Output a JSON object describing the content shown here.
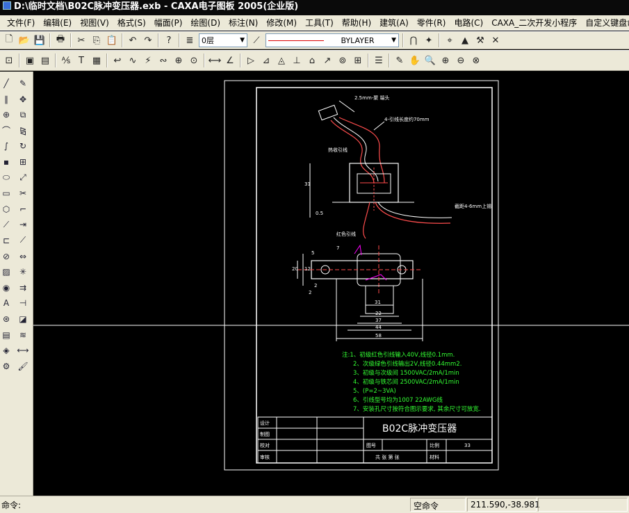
{
  "window": {
    "title": "D:\\临时文档\\B02C脉冲变压器.exb - CAXA电子图板 2005(企业版)"
  },
  "menu": [
    "文件(F)",
    "编辑(E)",
    "视图(V)",
    "格式(S)",
    "幅面(P)",
    "绘图(D)",
    "标注(N)",
    "修改(M)",
    "工具(T)",
    "帮助(H)",
    "建筑(A)",
    "零件(R)",
    "电路(C)",
    "CAXA_二次开发小程序",
    "自定义键盘命令"
  ],
  "toolbar": {
    "layer_value": "0层",
    "linetype_value": "BYLAYER"
  },
  "drawing": {
    "labels": {
      "top_lead": "2.5mm-聚 端头",
      "lead_wire": "4-引线长度约70mm",
      "heat_shrink": "热收引线",
      "dim_h": "31",
      "dim_small": "0.5",
      "right_lead": "截距4-6mm上锡",
      "red_lead": "红色引线",
      "dim_7": "7",
      "dim_a": "20",
      "dim_b": "12",
      "dim_c": "5",
      "dim_d": "2",
      "dim_e": "2",
      "dim_31": "31",
      "dim_22": "22",
      "dim_37": "37",
      "dim_44": "44",
      "dim_58": "58"
    },
    "notes": [
      "注:1、初级红色引线输入40V,线径0.1mm.",
      "2、次级绿色引线输出2V,线径0.44mm2.",
      "3、初级与次级间  1500VAC/2mA/1min",
      "4、初级与铁芯间  2500VAC/2mA/1min",
      "5、(P=2~3VA)",
      "6、引线型号均为1007 22AWG线",
      "7、安装孔尺寸按符合图示要求, 其余尺寸可放宽."
    ],
    "title_block": {
      "name": "B02C脉冲变压器",
      "row_design": "设计",
      "row_draw": "制图",
      "row_check": "校对",
      "row_audit": "审核",
      "drawing_no_label": "图号",
      "scale_label": "比例",
      "scale_value": "33",
      "material_label": "材料",
      "footer": "共 张 第 张"
    }
  },
  "status": {
    "command_prompt": "命令:",
    "idle_command": "空命令",
    "coordinates": "211.590,-38.981"
  },
  "colors": {
    "titlebar": "#0a0a0a",
    "chrome": "#ece9d8",
    "canvas": "#000000",
    "drawing_line": "#ffffff",
    "lead_red": "#ff4d4d",
    "note_green": "#33ff33",
    "magenta": "#ff00ff"
  }
}
